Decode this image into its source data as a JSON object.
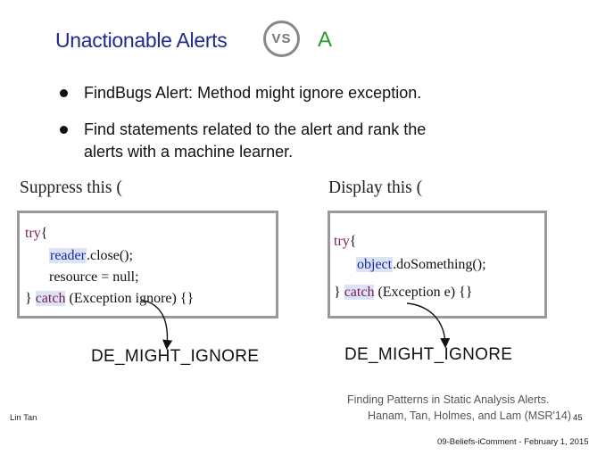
{
  "slide": {
    "title": "Unactionable Alerts",
    "vs_badge": "VS",
    "category_letter": "A",
    "bullets": [
      "FindBugs Alert: Method might ignore exception.",
      "Find statements related to the alert and rank the",
      "alerts with a machine learner."
    ],
    "left": {
      "heading": "Suppress this (",
      "code": {
        "l1_kw": "try",
        "l1_rest": "{",
        "l2_obj": "reader",
        "l2_rest": ".close();",
        "l3": "resource = null;",
        "l4_pre": "} ",
        "l4_kw": "catch",
        "l4_rest": " (Exception ignore) {}"
      },
      "pattern_label": "DE_MIGHT_IGNORE"
    },
    "right": {
      "heading": "Display this (",
      "code": {
        "l1_kw": "try",
        "l1_rest": "{",
        "l2_obj": "object",
        "l2_rest": ".doSomething();",
        "l3_pre": "} ",
        "l3_kw": "catch",
        "l3_rest": " (Exception e) {}"
      },
      "pattern_label": "DE_MIGHT_IGNORE"
    },
    "reference_line1": "Finding Patterns in Static Analysis Alerts.",
    "reference_line2": "Hanam, Tan, Holmes, and Lam (MSR'14)",
    "author": "Lin Tan",
    "page_number": "45",
    "footer": "09-Beliefs-iComment - February 1, 2015",
    "colors": {
      "title": "#1f2b8c",
      "letter": "#2e9b2e",
      "keyword": "#7a1a5a",
      "object": "#1a2aa8"
    }
  }
}
